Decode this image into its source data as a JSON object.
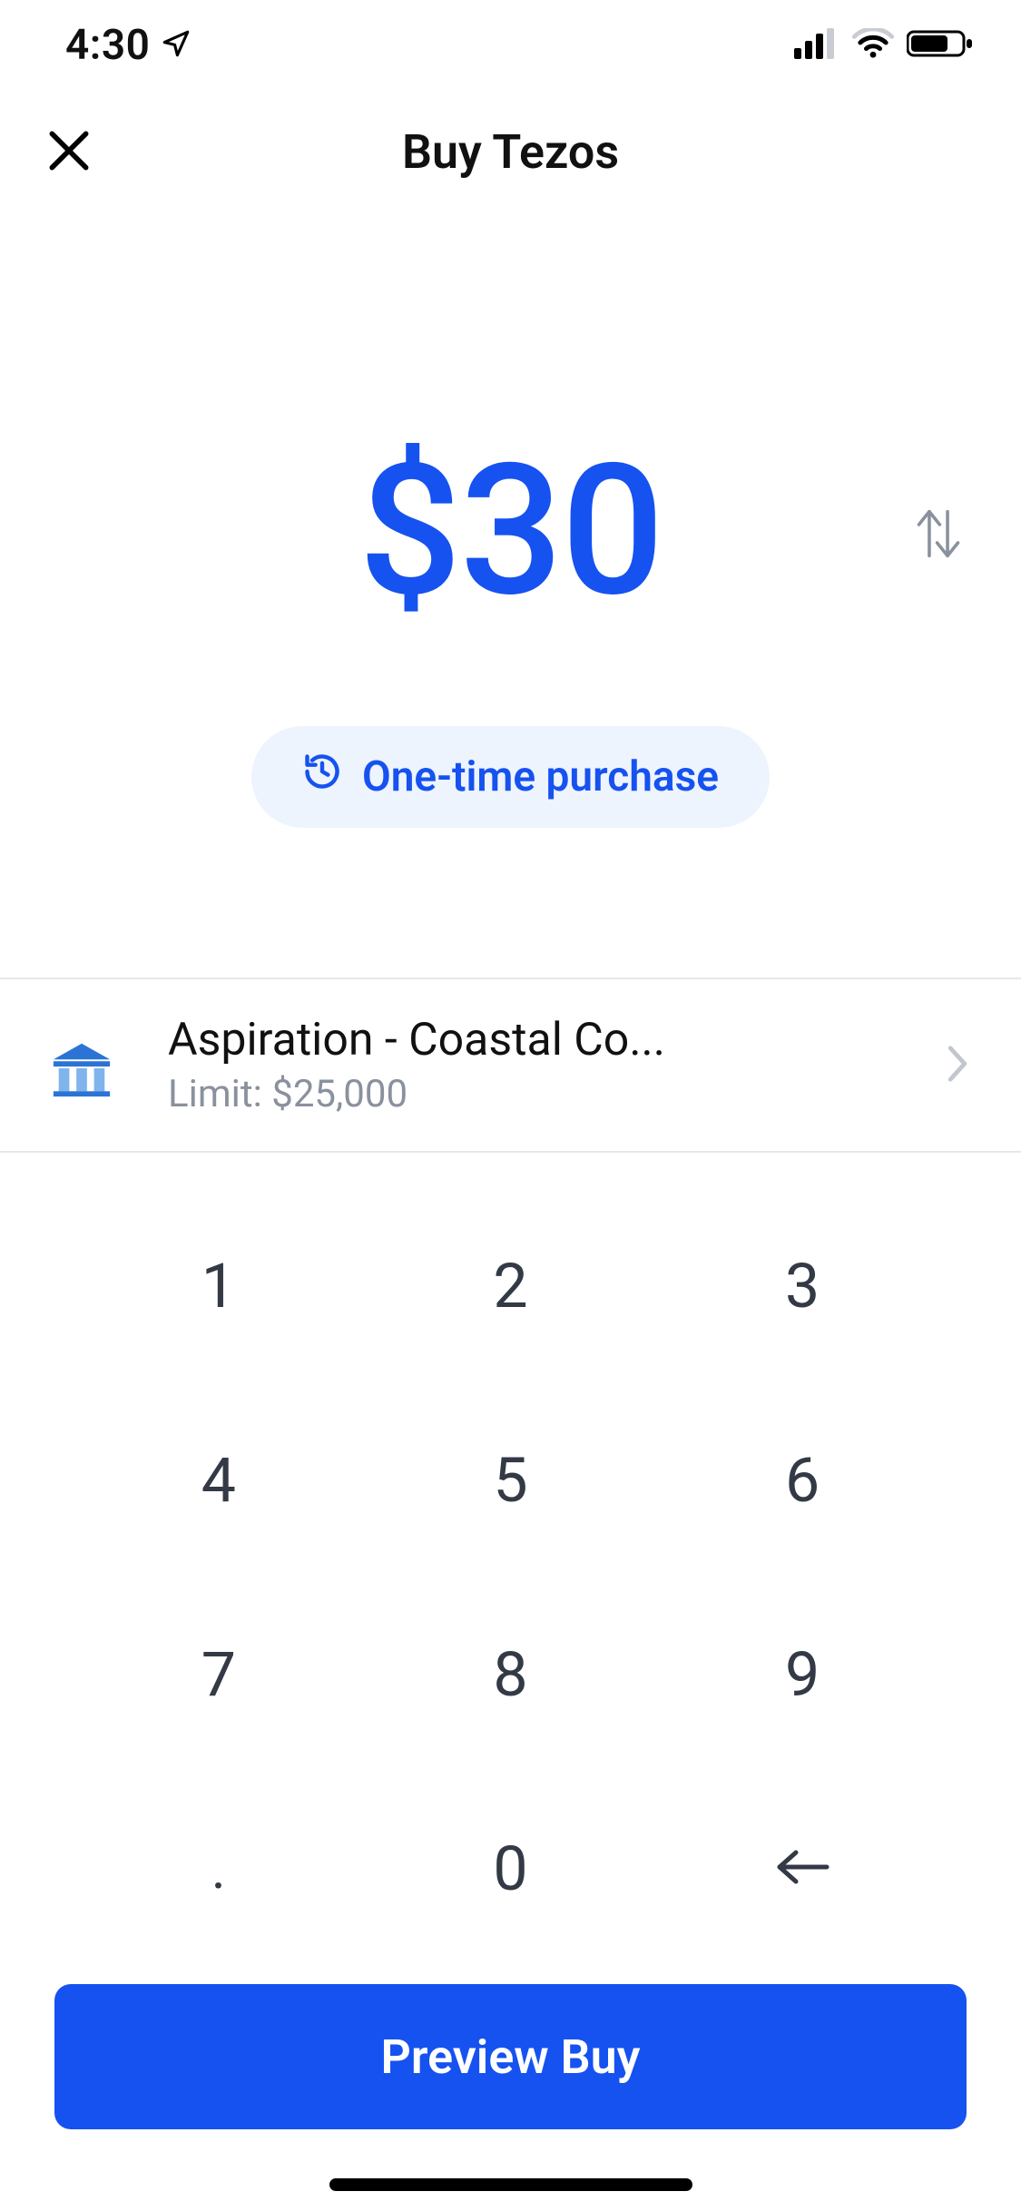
{
  "status": {
    "time": "4:30"
  },
  "nav": {
    "title": "Buy Tezos"
  },
  "amount": {
    "display": "$30"
  },
  "frequency": {
    "label": "One-time purchase"
  },
  "payment": {
    "name": "Aspiration - Coastal Co...",
    "limit": "Limit: $25,000"
  },
  "keypad": {
    "keys": [
      "1",
      "2",
      "3",
      "4",
      "5",
      "6",
      "7",
      "8",
      "9",
      ".",
      "0"
    ]
  },
  "cta": {
    "label": "Preview Buy"
  },
  "colors": {
    "accent": "#1652F0",
    "chipBg": "#EEF4FD"
  }
}
